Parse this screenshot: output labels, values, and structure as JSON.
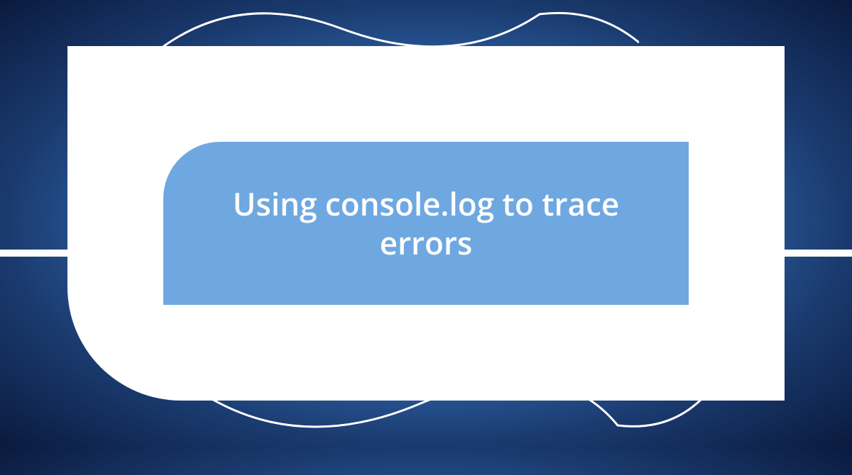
{
  "title": "Using console.log to trace errors",
  "colors": {
    "background_outer": "#0a1a3e",
    "background_mid": "#3a7bc8",
    "background_center": "#5a9de8",
    "frame": "#ffffff",
    "panel": "#6fa8e0",
    "text": "#ffffff"
  }
}
